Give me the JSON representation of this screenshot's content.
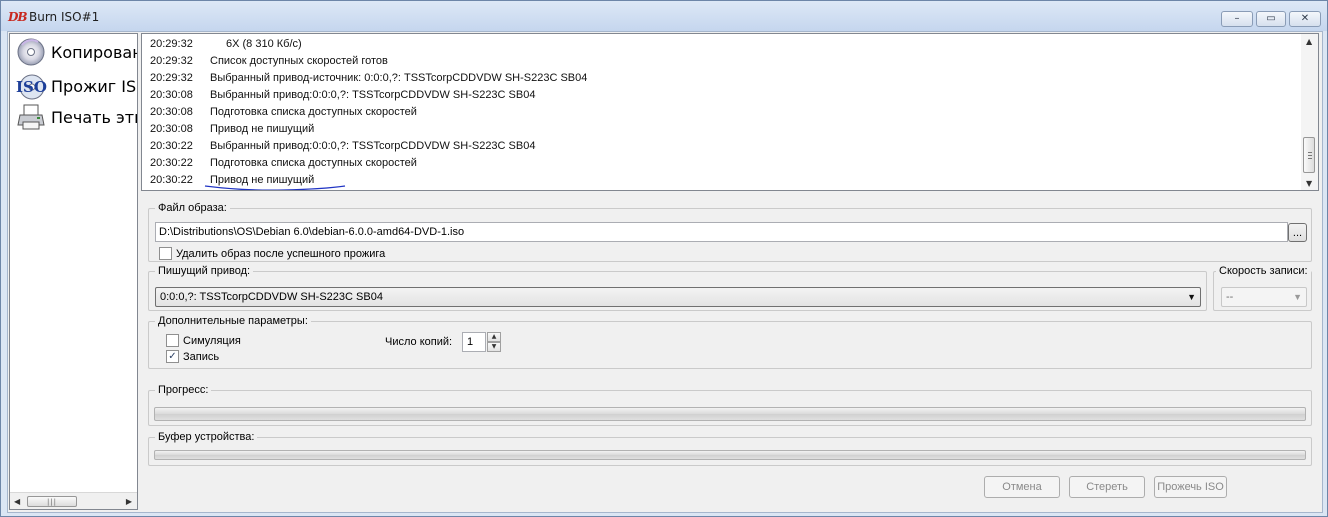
{
  "window": {
    "title": "Burn ISO#1",
    "app_icon_text": "DB",
    "minimize": "–",
    "restore": "▭",
    "close": "✕"
  },
  "sidebar": {
    "items": [
      {
        "label": "Копировани",
        "icon": "disc-copy-icon"
      },
      {
        "label": "Прожиг ISO",
        "icon": "iso-disc-icon"
      },
      {
        "label": "Печать эти",
        "icon": "printer-icon"
      }
    ],
    "scroll_left": "◀",
    "scroll_right": "▶",
    "scroll_grip": "|||"
  },
  "log": {
    "entries": [
      {
        "time": "20:29:32",
        "message": "6X (8 310 Кб/с)"
      },
      {
        "time": "20:29:32",
        "message": "Список доступных скоростей готов"
      },
      {
        "time": "20:29:32",
        "message": "Выбранный привод-источник: 0:0:0,?: TSSTcorpCDDVDW SH-S223C SB04"
      },
      {
        "time": "20:30:08",
        "message": "Выбранный привод:0:0:0,?: TSSTcorpCDDVDW SH-S223C SB04"
      },
      {
        "time": "20:30:08",
        "message": "Подготовка списка доступных скоростей"
      },
      {
        "time": "20:30:08",
        "message": "Привод не пишущий"
      },
      {
        "time": "20:30:22",
        "message": "Выбранный привод:0:0:0,?: TSSTcorpCDDVDW SH-S223C SB04"
      },
      {
        "time": "20:30:22",
        "message": "Подготовка списка доступных скоростей"
      },
      {
        "time": "20:30:22",
        "message": "Привод не пишущий"
      }
    ],
    "scroll_up": "▲",
    "scroll_down": "▼",
    "annotation_color": "#1f33c4"
  },
  "image_file": {
    "legend": "Файл образа:",
    "path": "D:\\Distributions\\OS\\Debian 6.0\\debian-6.0.0-amd64-DVD-1.iso",
    "browse_label": "...",
    "delete_after_label": "Удалить образ после успешного прожига",
    "delete_after_checked": false
  },
  "writer": {
    "legend": "Пишущий привод:",
    "selected": "0:0:0,?: TSSTcorpCDDVDW SH-S223C SB04",
    "dropdown_arrow": "▼"
  },
  "speed": {
    "legend": "Скорость записи:",
    "selected": "--",
    "dropdown_arrow": "▼"
  },
  "options": {
    "legend": "Дополнительные параметры:",
    "simulation_label": "Симуляция",
    "simulation_checked": false,
    "write_label": "Запись",
    "write_checked": true,
    "check_mark": "✓",
    "copies_label": "Число копий:",
    "copies_value": "1",
    "spin_up": "▲",
    "spin_down": "▼"
  },
  "progress": {
    "legend": "Прогресс:",
    "value": 0
  },
  "buffer": {
    "legend": "Буфер устройства:",
    "value": 0
  },
  "actions": {
    "cancel_label": "Отмена",
    "erase_label": "Стереть",
    "burn_label": "Прожечь ISO"
  }
}
